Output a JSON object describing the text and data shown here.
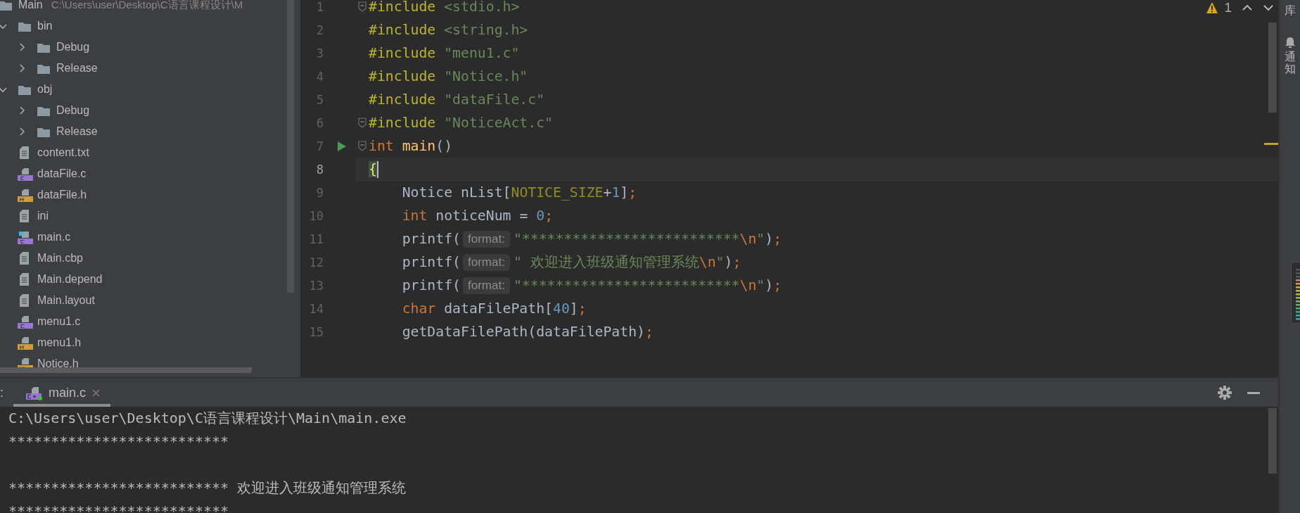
{
  "project": {
    "root": {
      "name": "Main",
      "path": "C:\\Users\\user\\Desktop\\C语言课程设计\\M"
    },
    "tree": [
      {
        "name": "bin",
        "kind": "folder",
        "expanded": true,
        "children": [
          {
            "name": "Debug",
            "kind": "folder",
            "expanded": false
          },
          {
            "name": "Release",
            "kind": "folder",
            "expanded": false
          }
        ]
      },
      {
        "name": "obj",
        "kind": "folder",
        "expanded": true,
        "children": [
          {
            "name": "Debug",
            "kind": "folder",
            "expanded": false
          },
          {
            "name": "Release",
            "kind": "folder",
            "expanded": false
          }
        ]
      },
      {
        "name": "content.txt",
        "kind": "text",
        "entry": false
      },
      {
        "name": "dataFile.c",
        "kind": "c",
        "entry": false
      },
      {
        "name": "dataFile.h",
        "kind": "h",
        "entry": false
      },
      {
        "name": "ini",
        "kind": "text",
        "entry": false
      },
      {
        "name": "main.c",
        "kind": "c",
        "entry": true
      },
      {
        "name": "Main.cbp",
        "kind": "text",
        "entry": false
      },
      {
        "name": "Main.depend",
        "kind": "text",
        "entry": false
      },
      {
        "name": "Main.layout",
        "kind": "text",
        "entry": false
      },
      {
        "name": "menu1.c",
        "kind": "c",
        "entry": false
      },
      {
        "name": "menu1.h",
        "kind": "h",
        "entry": false
      },
      {
        "name": "Notice.h",
        "kind": "h",
        "entry": false
      }
    ]
  },
  "editor": {
    "warnings": "1",
    "lines": [
      {
        "number": "1",
        "fold": true,
        "run": false,
        "current": false,
        "segments": [
          {
            "kind": "code",
            "tokens": [
              {
                "text": "#include ",
                "kind": "directive"
              },
              {
                "text": "<stdio.h>",
                "kind": "string"
              }
            ]
          }
        ]
      },
      {
        "number": "2",
        "fold": false,
        "run": false,
        "current": false,
        "segments": [
          {
            "kind": "code",
            "tokens": [
              {
                "text": "#include ",
                "kind": "directive"
              },
              {
                "text": "<string.h>",
                "kind": "string"
              }
            ]
          }
        ]
      },
      {
        "number": "3",
        "fold": false,
        "run": false,
        "current": false,
        "segments": [
          {
            "kind": "code",
            "tokens": [
              {
                "text": "#include ",
                "kind": "directive"
              },
              {
                "text": "\"menu1.c\"",
                "kind": "string"
              }
            ]
          }
        ]
      },
      {
        "number": "4",
        "fold": false,
        "run": false,
        "current": false,
        "segments": [
          {
            "kind": "code",
            "tokens": [
              {
                "text": "#include ",
                "kind": "directive"
              },
              {
                "text": "\"Notice.h\"",
                "kind": "string"
              }
            ]
          }
        ]
      },
      {
        "number": "5",
        "fold": false,
        "run": false,
        "current": false,
        "segments": [
          {
            "kind": "code",
            "tokens": [
              {
                "text": "#include ",
                "kind": "directive"
              },
              {
                "text": "\"dataFile.c\"",
                "kind": "string"
              }
            ]
          }
        ]
      },
      {
        "number": "6",
        "fold": true,
        "run": false,
        "current": false,
        "segments": [
          {
            "kind": "code",
            "tokens": [
              {
                "text": "#include ",
                "kind": "directive"
              },
              {
                "text": "\"NoticeAct.c\"",
                "kind": "string"
              }
            ]
          }
        ]
      },
      {
        "number": "7",
        "fold": true,
        "run": true,
        "current": false,
        "segments": [
          {
            "kind": "code",
            "tokens": [
              {
                "text": "int ",
                "kind": "keyword"
              },
              {
                "text": "main",
                "kind": "func"
              },
              {
                "text": "()",
                "kind": "plain"
              }
            ]
          }
        ]
      },
      {
        "number": "8",
        "fold": false,
        "run": false,
        "current": true,
        "segments": [
          {
            "kind": "code",
            "tokens": [
              {
                "text": "{",
                "kind": "brace_match"
              }
            ]
          }
        ]
      },
      {
        "number": "9",
        "fold": false,
        "run": false,
        "current": false,
        "segments": [
          {
            "kind": "code",
            "tokens": [
              {
                "text": "    Notice nList[",
                "kind": "plain"
              },
              {
                "text": "NOTICE_SIZE",
                "kind": "macro"
              },
              {
                "text": "+",
                "kind": "plain"
              },
              {
                "text": "1",
                "kind": "number"
              },
              {
                "text": "]",
                "kind": "plain"
              },
              {
                "text": ";",
                "kind": "punct"
              }
            ]
          }
        ]
      },
      {
        "number": "10",
        "fold": false,
        "run": false,
        "current": false,
        "segments": [
          {
            "kind": "code",
            "tokens": [
              {
                "text": "    int",
                "kind": "keyword"
              },
              {
                "text": " noticeNum = ",
                "kind": "plain"
              },
              {
                "text": "0",
                "kind": "number"
              },
              {
                "text": ";",
                "kind": "punct"
              }
            ]
          }
        ]
      },
      {
        "number": "11",
        "fold": false,
        "run": false,
        "current": false,
        "segments": [
          {
            "kind": "code",
            "tokens": [
              {
                "text": "    printf(",
                "kind": "plain"
              }
            ]
          },
          {
            "kind": "hint",
            "text": "format:"
          },
          {
            "kind": "code",
            "tokens": [
              {
                "text": "\"**************************",
                "kind": "string"
              },
              {
                "text": "\\n",
                "kind": "escape"
              },
              {
                "text": "\"",
                "kind": "string"
              },
              {
                "text": ")",
                "kind": "plain"
              },
              {
                "text": ";",
                "kind": "punct"
              }
            ]
          }
        ]
      },
      {
        "number": "12",
        "fold": false,
        "run": false,
        "current": false,
        "segments": [
          {
            "kind": "code",
            "tokens": [
              {
                "text": "    printf(",
                "kind": "plain"
              }
            ]
          },
          {
            "kind": "hint",
            "text": "format:"
          },
          {
            "kind": "code",
            "tokens": [
              {
                "text": "\" 欢迎进入班级通知管理系统",
                "kind": "string"
              },
              {
                "text": "\\n",
                "kind": "escape"
              },
              {
                "text": "\"",
                "kind": "string"
              },
              {
                "text": ")",
                "kind": "plain"
              },
              {
                "text": ";",
                "kind": "punct"
              }
            ]
          }
        ]
      },
      {
        "number": "13",
        "fold": false,
        "run": false,
        "current": false,
        "segments": [
          {
            "kind": "code",
            "tokens": [
              {
                "text": "    printf(",
                "kind": "plain"
              }
            ]
          },
          {
            "kind": "hint",
            "text": "format:"
          },
          {
            "kind": "code",
            "tokens": [
              {
                "text": "\"**************************",
                "kind": "string"
              },
              {
                "text": "\\n",
                "kind": "escape"
              },
              {
                "text": "\"",
                "kind": "string"
              },
              {
                "text": ")",
                "kind": "plain"
              },
              {
                "text": ";",
                "kind": "punct"
              }
            ]
          }
        ]
      },
      {
        "number": "14",
        "fold": false,
        "run": false,
        "current": false,
        "segments": [
          {
            "kind": "code",
            "tokens": [
              {
                "text": "    char",
                "kind": "keyword"
              },
              {
                "text": " dataFilePath[",
                "kind": "plain"
              },
              {
                "text": "40",
                "kind": "number"
              },
              {
                "text": "]",
                "kind": "plain"
              },
              {
                "text": ";",
                "kind": "punct"
              }
            ]
          }
        ]
      },
      {
        "number": "15",
        "fold": false,
        "run": false,
        "current": false,
        "segments": [
          {
            "kind": "code",
            "tokens": [
              {
                "text": "    getDataFilePath(dataFilePath)",
                "kind": "plain"
              },
              {
                "text": ";",
                "kind": "punct"
              }
            ]
          }
        ]
      }
    ]
  },
  "side_strip": {
    "items": [
      {
        "label": "库",
        "kind": "text"
      },
      {
        "label": "通知",
        "kind": "notifications"
      }
    ]
  },
  "run_panel": {
    "label": ":",
    "tabs": [
      {
        "title": "main.c",
        "selected": true
      }
    ],
    "console": [
      {
        "text": "C:\\Users\\user\\Desktop\\C语言课程设计\\Main\\main.exe",
        "blank_before": false
      },
      {
        "text": "**************************",
        "blank_before": false
      },
      {
        "text": "************************** 欢迎进入班级通知管理系统",
        "blank_before": true
      },
      {
        "text": "**************************",
        "blank_before": false
      }
    ]
  }
}
